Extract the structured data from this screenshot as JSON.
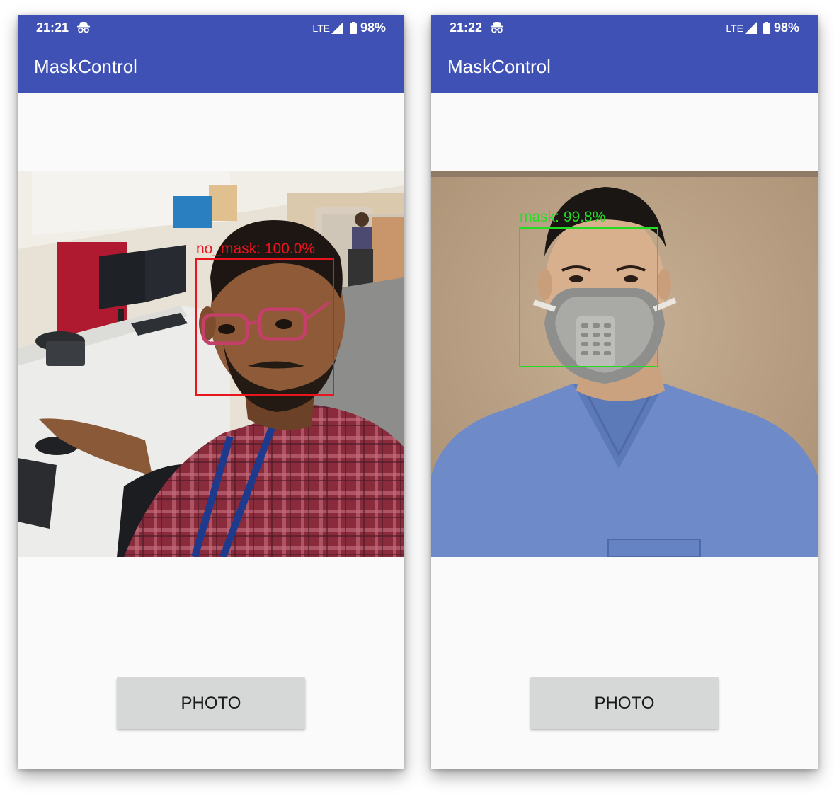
{
  "screens": [
    {
      "status": {
        "time": "21:21",
        "network": "LTE",
        "battery": "98%"
      },
      "app_title": "MaskControl",
      "detection": {
        "label": "no_mask: 100.0%",
        "color": "#e8141e"
      },
      "button_label": "PHOTO"
    },
    {
      "status": {
        "time": "21:22",
        "network": "LTE",
        "battery": "98%"
      },
      "app_title": "MaskControl",
      "detection": {
        "label": "mask: 99.8%",
        "color": "#22dd22"
      },
      "button_label": "PHOTO"
    }
  ],
  "colors": {
    "app_bar": "#3f51b5",
    "background": "#fafafa",
    "button": "#d6d7d7"
  },
  "icons": [
    "incognito-icon",
    "signal-icon",
    "battery-icon"
  ]
}
